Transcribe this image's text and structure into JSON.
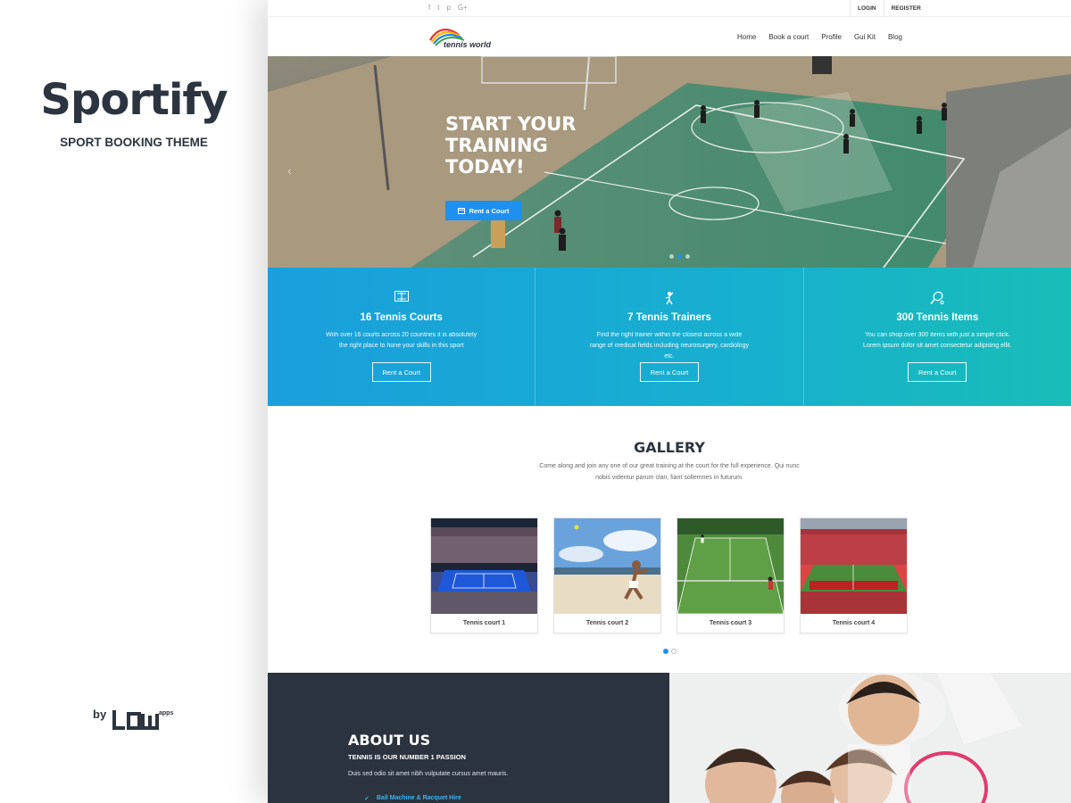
{
  "promo": {
    "title": "Sportify",
    "subtitle": "SPORT BOOKING THEME",
    "by": "by"
  },
  "topbar": {
    "social": [
      "f",
      "t",
      "p",
      "G+"
    ],
    "login": "LOGIN",
    "register": "REGISTER"
  },
  "nav": {
    "items": [
      "Home",
      "Book a court",
      "Profile",
      "Gui Kit",
      "Blog"
    ]
  },
  "hero": {
    "title_lines": [
      "START YOUR",
      "TRAINING",
      "TODAY!"
    ],
    "button": "Rent a Court",
    "slides": 3,
    "active_slide": 2
  },
  "features": [
    {
      "icon": "tennis-court-icon",
      "title": "16 Tennis Courts",
      "text": "With over 16 courts across 20 countries it is absolutely the right place to hone your skills in this sport",
      "button": "Rent a Court"
    },
    {
      "icon": "tennis-player-icon",
      "title": "7 Tennis Trainers",
      "text": "Find the right trainer within the closest across a wide range of medical fields including neurosurgery, cardiology etc.",
      "button": "Rent a Court"
    },
    {
      "icon": "tennis-racquet-icon",
      "title": "300 Tennis Items",
      "text": "You can shop over 300 items with just a simple click. Lorem ipsum dolor sit amet consectetur adipising ellit.",
      "button": "Rent a Court"
    }
  ],
  "gallery": {
    "title": "GALLERY",
    "description": "Come along and join any one of our great training at the court for the full experience. Qui nunc nobis videntur parum clari, fiant sollemnes in futurum.",
    "cards": [
      {
        "caption": "Tennis court 1",
        "image": "stadium-night-photo"
      },
      {
        "caption": "Tennis court 2",
        "image": "beach-tennis-photo"
      },
      {
        "caption": "Tennis court 3",
        "image": "grass-court-photo"
      },
      {
        "caption": "Tennis court 4",
        "image": "football-stadium-photo"
      }
    ],
    "pages": 2,
    "active_page": 1
  },
  "about": {
    "title": "ABOUT US",
    "subtitle": "TENNIS IS OUR NUMBER 1 PASSION",
    "text": "Duis sed odio sit amet nibh vulputate cursus amet mauris.",
    "items": [
      "Ball Machine & Racquet Hire"
    ]
  },
  "colors": {
    "accent": "#1e90ef",
    "dark": "#2b333f",
    "feature_start": "#1a9fdc",
    "feature_end": "#19bdb7"
  }
}
